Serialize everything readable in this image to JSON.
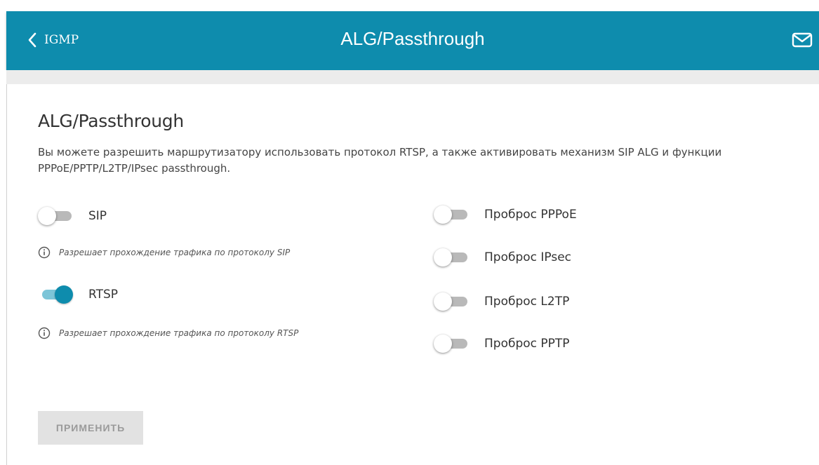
{
  "header": {
    "back_label": "IGMP",
    "title": "ALG/Passthrough",
    "mail_icon": "mail-icon",
    "color": "#0e8cad"
  },
  "section": {
    "title": "ALG/Passthrough",
    "description": "Вы можете разрешить маршрутизатору использовать протокол RTSP, а также активировать механизм SIP ALG и функции PPPoE/PPTP/L2TP/IPsec passthrough."
  },
  "toggles_left": [
    {
      "label": "SIP",
      "enabled": false,
      "hint": "Разрешает прохождение трафика по протоколу SIP"
    },
    {
      "label": "RTSP",
      "enabled": true,
      "hint": "Разрешает прохождение трафика по протоколу RTSP"
    }
  ],
  "toggles_right": [
    {
      "label": "Проброс PPPoE",
      "enabled": false
    },
    {
      "label": "Проброс IPsec",
      "enabled": false
    },
    {
      "label": "Проброс L2TP",
      "enabled": false
    },
    {
      "label": "Проброс PPTP",
      "enabled": false
    }
  ],
  "apply_button": {
    "label": "ПРИМЕНИТЬ",
    "disabled": true
  },
  "colors": {
    "accent": "#0e8cad",
    "switch_on_track": "#7cc5d8",
    "switch_off_track": "#b9b9b9"
  }
}
